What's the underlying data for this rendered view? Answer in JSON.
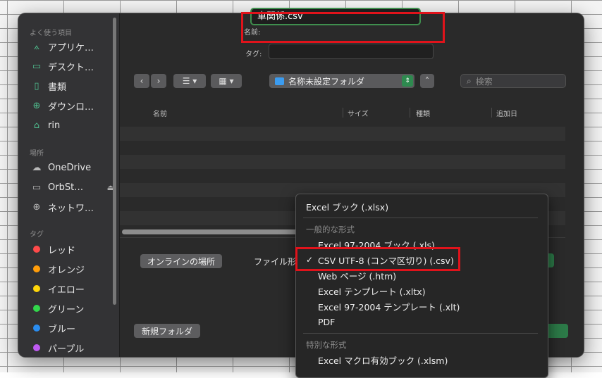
{
  "sidebar": {
    "favorites_heading": "よく使う項目",
    "favorites": [
      {
        "label": "アプリケ…",
        "icon": "applications-icon"
      },
      {
        "label": "デスクト…",
        "icon": "desktop-icon"
      },
      {
        "label": "書類",
        "icon": "documents-icon"
      },
      {
        "label": "ダウンロ…",
        "icon": "downloads-icon"
      },
      {
        "label": "rin",
        "icon": "home-icon"
      }
    ],
    "locations_heading": "場所",
    "locations": [
      {
        "label": "OneDrive",
        "icon": "cloud-icon"
      },
      {
        "label": "OrbSt…",
        "icon": "computer-icon"
      },
      {
        "label": "ネットワ…",
        "icon": "network-icon"
      }
    ],
    "tags_heading": "タグ",
    "tags": [
      {
        "label": "レッド",
        "color": "#ff4a4a"
      },
      {
        "label": "オレンジ",
        "color": "#ff9d0a"
      },
      {
        "label": "イエロー",
        "color": "#ffd60a"
      },
      {
        "label": "グリーン",
        "color": "#32d74b"
      },
      {
        "label": "ブルー",
        "color": "#2a8df0"
      },
      {
        "label": "パープル",
        "color": "#bf5af2"
      }
    ]
  },
  "save": {
    "name_label": "名前:",
    "name_value": "車関係.csv",
    "tag_label": "タグ:",
    "tag_value": ""
  },
  "toolbar": {
    "back_icon": "chevron-left-icon",
    "forward_icon": "chevron-right-icon",
    "list_view_icon": "list-icon",
    "grid_view_icon": "grid-icon",
    "folder": "名称未設定フォルダ",
    "search_placeholder": "検索"
  },
  "columns": [
    "名前",
    "サイズ",
    "種類",
    "追加日"
  ],
  "buttons": {
    "online": "オンラインの場所",
    "new_folder": "新規フォルダ"
  },
  "format_label": "ファイル形",
  "format_menu": {
    "top_item": "Excel ブック (.xlsx)",
    "common_heading": "一般的な形式",
    "common_items": [
      {
        "label": "Excel 97-2004 ブック (.xls)",
        "checked": false
      },
      {
        "label": "CSV UTF-8 (コンマ区切り) (.csv)",
        "checked": true
      },
      {
        "label": "Web ページ (.htm)",
        "checked": false
      },
      {
        "label": "Excel テンプレート (.xltx)",
        "checked": false
      },
      {
        "label": "Excel 97-2004 テンプレート (.xlt)",
        "checked": false
      },
      {
        "label": "PDF",
        "checked": false
      }
    ],
    "special_heading": "特別な形式",
    "special_items": [
      {
        "label": "Excel マクロ有効ブック (.xlsm)",
        "checked": false
      }
    ],
    "check_mark": "✓"
  },
  "colors": {
    "highlight_red": "#e0131b",
    "focus_green": "#3f8f4e",
    "folder_blue": "#3b9cf0"
  }
}
